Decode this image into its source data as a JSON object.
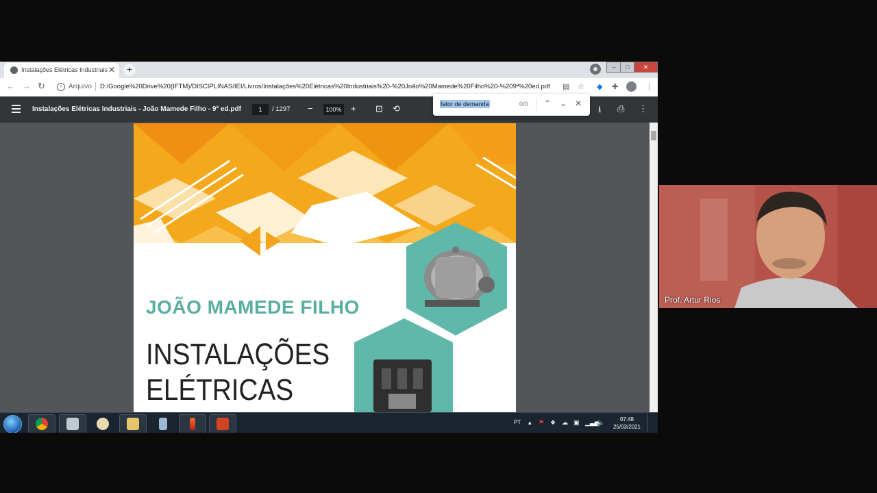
{
  "browser": {
    "tab_title": "Instalações Elétricas Industriais -",
    "new_tab_label": "+",
    "address_scheme": "Arquivo",
    "url": "D:/Google%20Drive%20(IFTM)/DISCIPLINAS/IEI/Livros/Instalações%20Elétricas%20Industriais%20-%20João%20Mamede%20Filho%20-%209ª%20ed.pdf"
  },
  "pdf_viewer": {
    "document_title": "Instalações Elétricas Industriais - João Mamede Filho - 9ª ed.pdf",
    "current_page": "1",
    "total_pages": "/ 1297",
    "zoom": "100%"
  },
  "find_bar": {
    "query": "fator de demanda",
    "result_count": "0/0"
  },
  "book_cover": {
    "author": "JOÃO MAMEDE FILHO",
    "title_line1": "INSTALAÇÕES",
    "title_line2": "ELÉTRICAS",
    "accent_orange": "#f2a51c",
    "accent_teal": "#5fb8a9"
  },
  "taskbar": {
    "language": "PT",
    "time": "07:48",
    "date": "25/03/2021",
    "apps": [
      "chrome-icon",
      "snipping-tool-icon",
      "paint-icon",
      "file-explorer-icon",
      "calculator-icon",
      "pen-tool-icon",
      "powerpoint-icon"
    ]
  },
  "webcam": {
    "participant_name": "Prof. Artur Rios"
  }
}
